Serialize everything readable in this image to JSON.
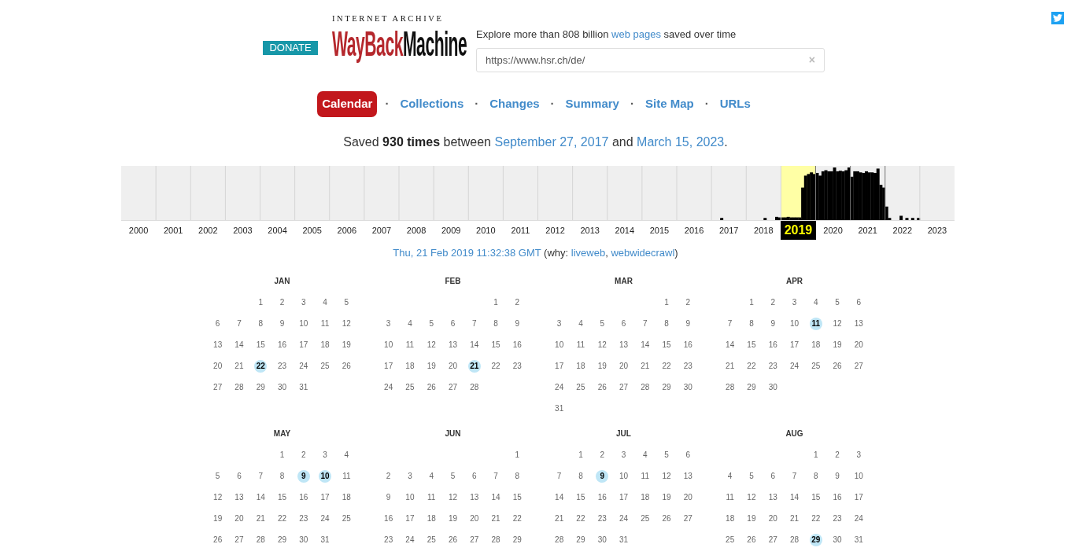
{
  "header": {
    "donate_button": "DONATE",
    "logo": {
      "top_line": "INTERNET ARCHIVE",
      "wordmark_red": "WayBack",
      "wordmark_black": "Machine"
    },
    "tagline": [
      {
        "kind": "text",
        "text": "Explore more than 808 billion"
      },
      {
        "kind": "link",
        "text": "web pages"
      },
      {
        "kind": "text",
        "text": "saved over time"
      }
    ],
    "search": {
      "value": "https://www.hsr.ch/de/",
      "clear": "×"
    }
  },
  "tabs": [
    {
      "label": "Calendar",
      "selected": true
    },
    {
      "label": "Collections",
      "selected": false
    },
    {
      "label": "Changes",
      "selected": false
    },
    {
      "label": "Summary",
      "selected": false
    },
    {
      "label": "Site Map",
      "selected": false
    },
    {
      "label": "URLs",
      "selected": false
    }
  ],
  "tab_separator": "·",
  "summary": [
    {
      "kind": "text",
      "text": "Saved"
    },
    {
      "kind": "bold",
      "text": "930 times"
    },
    {
      "kind": "text",
      "text": "between"
    },
    {
      "kind": "link",
      "text": "September 27, 2017"
    },
    {
      "kind": "text",
      "text": "and"
    },
    {
      "kind": "link",
      "text": "March 15, 2023"
    },
    {
      "kind": "punct",
      "text": "."
    }
  ],
  "years": [
    {
      "label": "2000",
      "selected": false
    },
    {
      "label": "2001",
      "selected": false
    },
    {
      "label": "2002",
      "selected": false
    },
    {
      "label": "2003",
      "selected": false
    },
    {
      "label": "2004",
      "selected": false
    },
    {
      "label": "2005",
      "selected": false
    },
    {
      "label": "2006",
      "selected": false
    },
    {
      "label": "2007",
      "selected": false
    },
    {
      "label": "2008",
      "selected": false
    },
    {
      "label": "2009",
      "selected": false
    },
    {
      "label": "2010",
      "selected": false
    },
    {
      "label": "2011",
      "selected": false
    },
    {
      "label": "2012",
      "selected": false
    },
    {
      "label": "2013",
      "selected": false
    },
    {
      "label": "2014",
      "selected": false
    },
    {
      "label": "2015",
      "selected": false
    },
    {
      "label": "2016",
      "selected": false
    },
    {
      "label": "2017",
      "selected": false
    },
    {
      "label": "2018",
      "selected": false
    },
    {
      "label": "2019",
      "selected": true
    },
    {
      "label": "2020",
      "selected": false
    },
    {
      "label": "2021",
      "selected": false
    },
    {
      "label": "2022",
      "selected": false
    },
    {
      "label": "2023",
      "selected": false
    }
  ],
  "capture_line": [
    {
      "kind": "link",
      "text": "Thu, 21 Feb 2019 11:32:38 GMT"
    },
    {
      "kind": "text",
      "text": "(why:"
    },
    {
      "kind": "link",
      "text": "liveweb"
    },
    {
      "kind": "punct",
      "text": ","
    },
    {
      "kind": "link",
      "text": "webwidecrawl"
    },
    {
      "kind": "punct",
      "text": ")"
    }
  ],
  "months": [
    {
      "name": "JAN",
      "weeks": [
        [
          {
            "day": "1",
            "captured": false
          },
          {
            "day": "2",
            "captured": false
          },
          {
            "day": "3",
            "captured": false
          },
          {
            "day": "4",
            "captured": false
          },
          {
            "day": "5",
            "captured": false
          }
        ],
        [
          {
            "day": "6",
            "captured": false
          },
          {
            "day": "7",
            "captured": false
          },
          {
            "day": "8",
            "captured": false
          },
          {
            "day": "9",
            "captured": false
          },
          {
            "day": "10",
            "captured": false
          },
          {
            "day": "11",
            "captured": false
          },
          {
            "day": "12",
            "captured": false
          }
        ],
        [
          {
            "day": "13",
            "captured": false
          },
          {
            "day": "14",
            "captured": false
          },
          {
            "day": "15",
            "captured": false
          },
          {
            "day": "16",
            "captured": false
          },
          {
            "day": "17",
            "captured": false
          },
          {
            "day": "18",
            "captured": false
          },
          {
            "day": "19",
            "captured": false
          }
        ],
        [
          {
            "day": "20",
            "captured": false
          },
          {
            "day": "21",
            "captured": false
          },
          {
            "day": "22",
            "captured": true
          },
          {
            "day": "23",
            "captured": false
          },
          {
            "day": "24",
            "captured": false
          },
          {
            "day": "25",
            "captured": false
          },
          {
            "day": "26",
            "captured": false
          }
        ],
        [
          {
            "day": "27",
            "captured": false
          },
          {
            "day": "28",
            "captured": false
          },
          {
            "day": "29",
            "captured": false
          },
          {
            "day": "30",
            "captured": false
          },
          {
            "day": "31",
            "captured": false
          }
        ]
      ]
    },
    {
      "name": "FEB",
      "weeks": [
        [
          {
            "day": "1",
            "captured": false
          },
          {
            "day": "2",
            "captured": false
          }
        ],
        [
          {
            "day": "3",
            "captured": false
          },
          {
            "day": "4",
            "captured": false
          },
          {
            "day": "5",
            "captured": false
          },
          {
            "day": "6",
            "captured": false
          },
          {
            "day": "7",
            "captured": false
          },
          {
            "day": "8",
            "captured": false
          },
          {
            "day": "9",
            "captured": false
          }
        ],
        [
          {
            "day": "10",
            "captured": false
          },
          {
            "day": "11",
            "captured": false
          },
          {
            "day": "12",
            "captured": false
          },
          {
            "day": "13",
            "captured": false
          },
          {
            "day": "14",
            "captured": false
          },
          {
            "day": "15",
            "captured": false
          },
          {
            "day": "16",
            "captured": false
          }
        ],
        [
          {
            "day": "17",
            "captured": false
          },
          {
            "day": "18",
            "captured": false
          },
          {
            "day": "19",
            "captured": false
          },
          {
            "day": "20",
            "captured": false
          },
          {
            "day": "21",
            "captured": true
          },
          {
            "day": "22",
            "captured": false
          },
          {
            "day": "23",
            "captured": false
          }
        ],
        [
          {
            "day": "24",
            "captured": false
          },
          {
            "day": "25",
            "captured": false
          },
          {
            "day": "26",
            "captured": false
          },
          {
            "day": "27",
            "captured": false
          },
          {
            "day": "28",
            "captured": false
          }
        ]
      ]
    },
    {
      "name": "MAR",
      "weeks": [
        [
          {
            "day": "1",
            "captured": false
          },
          {
            "day": "2",
            "captured": false
          }
        ],
        [
          {
            "day": "3",
            "captured": false
          },
          {
            "day": "4",
            "captured": false
          },
          {
            "day": "5",
            "captured": false
          },
          {
            "day": "6",
            "captured": false
          },
          {
            "day": "7",
            "captured": false
          },
          {
            "day": "8",
            "captured": false
          },
          {
            "day": "9",
            "captured": false
          }
        ],
        [
          {
            "day": "10",
            "captured": false
          },
          {
            "day": "11",
            "captured": false
          },
          {
            "day": "12",
            "captured": false
          },
          {
            "day": "13",
            "captured": false
          },
          {
            "day": "14",
            "captured": false
          },
          {
            "day": "15",
            "captured": false
          },
          {
            "day": "16",
            "captured": false
          }
        ],
        [
          {
            "day": "17",
            "captured": false
          },
          {
            "day": "18",
            "captured": false
          },
          {
            "day": "19",
            "captured": false
          },
          {
            "day": "20",
            "captured": false
          },
          {
            "day": "21",
            "captured": false
          },
          {
            "day": "22",
            "captured": false
          },
          {
            "day": "23",
            "captured": false
          }
        ],
        [
          {
            "day": "24",
            "captured": false
          },
          {
            "day": "25",
            "captured": false
          },
          {
            "day": "26",
            "captured": false
          },
          {
            "day": "27",
            "captured": false
          },
          {
            "day": "28",
            "captured": false
          },
          {
            "day": "29",
            "captured": false
          },
          {
            "day": "30",
            "captured": false
          }
        ],
        [
          {
            "day": "31",
            "captured": false
          }
        ]
      ]
    },
    {
      "name": "APR",
      "weeks": [
        [
          {
            "day": "1",
            "captured": false
          },
          {
            "day": "2",
            "captured": false
          },
          {
            "day": "3",
            "captured": false
          },
          {
            "day": "4",
            "captured": false
          },
          {
            "day": "5",
            "captured": false
          },
          {
            "day": "6",
            "captured": false
          }
        ],
        [
          {
            "day": "7",
            "captured": false
          },
          {
            "day": "8",
            "captured": false
          },
          {
            "day": "9",
            "captured": false
          },
          {
            "day": "10",
            "captured": false
          },
          {
            "day": "11",
            "captured": true
          },
          {
            "day": "12",
            "captured": false
          },
          {
            "day": "13",
            "captured": false
          }
        ],
        [
          {
            "day": "14",
            "captured": false
          },
          {
            "day": "15",
            "captured": false
          },
          {
            "day": "16",
            "captured": false
          },
          {
            "day": "17",
            "captured": false
          },
          {
            "day": "18",
            "captured": false
          },
          {
            "day": "19",
            "captured": false
          },
          {
            "day": "20",
            "captured": false
          }
        ],
        [
          {
            "day": "21",
            "captured": false
          },
          {
            "day": "22",
            "captured": false
          },
          {
            "day": "23",
            "captured": false
          },
          {
            "day": "24",
            "captured": false
          },
          {
            "day": "25",
            "captured": false
          },
          {
            "day": "26",
            "captured": false
          },
          {
            "day": "27",
            "captured": false
          }
        ],
        [
          {
            "day": "28",
            "captured": false
          },
          {
            "day": "29",
            "captured": false
          },
          {
            "day": "30",
            "captured": false
          }
        ]
      ]
    },
    {
      "name": "MAY",
      "weeks": [
        [
          {
            "day": "1",
            "captured": false
          },
          {
            "day": "2",
            "captured": false
          },
          {
            "day": "3",
            "captured": false
          },
          {
            "day": "4",
            "captured": false
          }
        ],
        [
          {
            "day": "5",
            "captured": false
          },
          {
            "day": "6",
            "captured": false
          },
          {
            "day": "7",
            "captured": false
          },
          {
            "day": "8",
            "captured": false
          },
          {
            "day": "9",
            "captured": true
          },
          {
            "day": "10",
            "captured": true
          },
          {
            "day": "11",
            "captured": false
          }
        ],
        [
          {
            "day": "12",
            "captured": false
          },
          {
            "day": "13",
            "captured": false
          },
          {
            "day": "14",
            "captured": false
          },
          {
            "day": "15",
            "captured": false
          },
          {
            "day": "16",
            "captured": false
          },
          {
            "day": "17",
            "captured": false
          },
          {
            "day": "18",
            "captured": false
          }
        ],
        [
          {
            "day": "19",
            "captured": false
          },
          {
            "day": "20",
            "captured": false
          },
          {
            "day": "21",
            "captured": false
          },
          {
            "day": "22",
            "captured": false
          },
          {
            "day": "23",
            "captured": false
          },
          {
            "day": "24",
            "captured": false
          },
          {
            "day": "25",
            "captured": false
          }
        ],
        [
          {
            "day": "26",
            "captured": false
          },
          {
            "day": "27",
            "captured": false
          },
          {
            "day": "28",
            "captured": false
          },
          {
            "day": "29",
            "captured": false
          },
          {
            "day": "30",
            "captured": false
          },
          {
            "day": "31",
            "captured": false
          }
        ]
      ]
    },
    {
      "name": "JUN",
      "weeks": [
        [
          {
            "day": "1",
            "captured": false
          }
        ],
        [
          {
            "day": "2",
            "captured": false
          },
          {
            "day": "3",
            "captured": false
          },
          {
            "day": "4",
            "captured": false
          },
          {
            "day": "5",
            "captured": false
          },
          {
            "day": "6",
            "captured": false
          },
          {
            "day": "7",
            "captured": false
          },
          {
            "day": "8",
            "captured": false
          }
        ],
        [
          {
            "day": "9",
            "captured": false
          },
          {
            "day": "10",
            "captured": false
          },
          {
            "day": "11",
            "captured": false
          },
          {
            "day": "12",
            "captured": false
          },
          {
            "day": "13",
            "captured": false
          },
          {
            "day": "14",
            "captured": false
          },
          {
            "day": "15",
            "captured": false
          }
        ],
        [
          {
            "day": "16",
            "captured": false
          },
          {
            "day": "17",
            "captured": false
          },
          {
            "day": "18",
            "captured": false
          },
          {
            "day": "19",
            "captured": false
          },
          {
            "day": "20",
            "captured": false
          },
          {
            "day": "21",
            "captured": false
          },
          {
            "day": "22",
            "captured": false
          }
        ],
        [
          {
            "day": "23",
            "captured": false
          },
          {
            "day": "24",
            "captured": false
          },
          {
            "day": "25",
            "captured": false
          },
          {
            "day": "26",
            "captured": false
          },
          {
            "day": "27",
            "captured": false
          },
          {
            "day": "28",
            "captured": false
          },
          {
            "day": "29",
            "captured": false
          }
        ]
      ]
    },
    {
      "name": "JUL",
      "weeks": [
        [
          {
            "day": "1",
            "captured": false
          },
          {
            "day": "2",
            "captured": false
          },
          {
            "day": "3",
            "captured": false
          },
          {
            "day": "4",
            "captured": false
          },
          {
            "day": "5",
            "captured": false
          },
          {
            "day": "6",
            "captured": false
          }
        ],
        [
          {
            "day": "7",
            "captured": false
          },
          {
            "day": "8",
            "captured": false
          },
          {
            "day": "9",
            "captured": true
          },
          {
            "day": "10",
            "captured": false
          },
          {
            "day": "11",
            "captured": false
          },
          {
            "day": "12",
            "captured": false
          },
          {
            "day": "13",
            "captured": false
          }
        ],
        [
          {
            "day": "14",
            "captured": false
          },
          {
            "day": "15",
            "captured": false
          },
          {
            "day": "16",
            "captured": false
          },
          {
            "day": "17",
            "captured": false
          },
          {
            "day": "18",
            "captured": false
          },
          {
            "day": "19",
            "captured": false
          },
          {
            "day": "20",
            "captured": false
          }
        ],
        [
          {
            "day": "21",
            "captured": false
          },
          {
            "day": "22",
            "captured": false
          },
          {
            "day": "23",
            "captured": false
          },
          {
            "day": "24",
            "captured": false
          },
          {
            "day": "25",
            "captured": false
          },
          {
            "day": "26",
            "captured": false
          },
          {
            "day": "27",
            "captured": false
          }
        ],
        [
          {
            "day": "28",
            "captured": false
          },
          {
            "day": "29",
            "captured": false
          },
          {
            "day": "30",
            "captured": false
          },
          {
            "day": "31",
            "captured": false
          }
        ]
      ]
    },
    {
      "name": "AUG",
      "weeks": [
        [
          {
            "day": "1",
            "captured": false
          },
          {
            "day": "2",
            "captured": false
          },
          {
            "day": "3",
            "captured": false
          }
        ],
        [
          {
            "day": "4",
            "captured": false
          },
          {
            "day": "5",
            "captured": false
          },
          {
            "day": "6",
            "captured": false
          },
          {
            "day": "7",
            "captured": false
          },
          {
            "day": "8",
            "captured": false
          },
          {
            "day": "9",
            "captured": false
          },
          {
            "day": "10",
            "captured": false
          }
        ],
        [
          {
            "day": "11",
            "captured": false
          },
          {
            "day": "12",
            "captured": false
          },
          {
            "day": "13",
            "captured": false
          },
          {
            "day": "14",
            "captured": false
          },
          {
            "day": "15",
            "captured": false
          },
          {
            "day": "16",
            "captured": false
          },
          {
            "day": "17",
            "captured": false
          }
        ],
        [
          {
            "day": "18",
            "captured": false
          },
          {
            "day": "19",
            "captured": false
          },
          {
            "day": "20",
            "captured": false
          },
          {
            "day": "21",
            "captured": false
          },
          {
            "day": "22",
            "captured": false
          },
          {
            "day": "23",
            "captured": false
          },
          {
            "day": "24",
            "captured": false
          }
        ],
        [
          {
            "day": "25",
            "captured": false
          },
          {
            "day": "26",
            "captured": false
          },
          {
            "day": "27",
            "captured": false
          },
          {
            "day": "28",
            "captured": false
          },
          {
            "day": "29",
            "captured": true
          },
          {
            "day": "30",
            "captured": false
          },
          {
            "day": "31",
            "captured": false
          }
        ]
      ]
    }
  ]
}
